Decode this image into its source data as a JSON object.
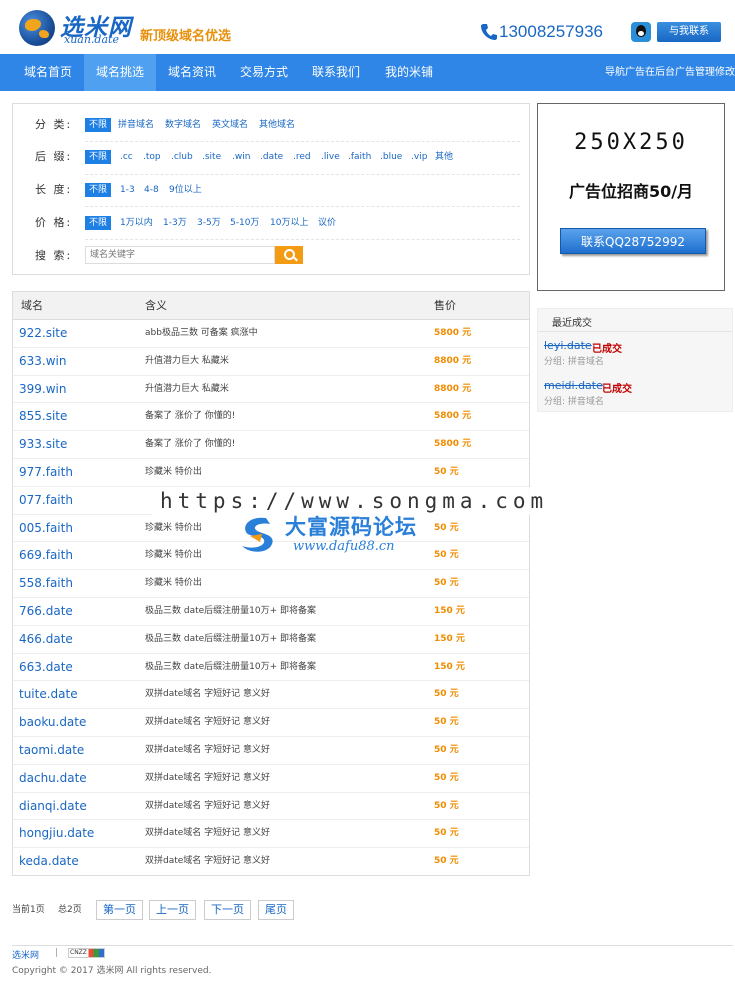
{
  "header": {
    "logo_text": "选米网",
    "logo_sub": "xuan.date",
    "slogan": "新顶级域名优选",
    "phone": "13008257936",
    "contact_button": "与我联系"
  },
  "nav": {
    "items": [
      {
        "label": "域名首页",
        "active": false
      },
      {
        "label": "域名挑选",
        "active": true
      },
      {
        "label": "域名资讯",
        "active": false
      },
      {
        "label": "交易方式",
        "active": false
      },
      {
        "label": "联系我们",
        "active": false
      },
      {
        "label": "我的米铺",
        "active": false
      }
    ],
    "notice": "导航广告在后台广告管理修改"
  },
  "filters": {
    "category": {
      "label": "分 类:",
      "options": [
        "不限",
        "拼音域名",
        "数字域名",
        "英文域名",
        "其他域名"
      ]
    },
    "suffix": {
      "label": "后 缀:",
      "options": [
        "不限",
        ".cc",
        ".top",
        ".club",
        ".site",
        ".win",
        ".date",
        ".red",
        ".live",
        ".faith",
        ".blue",
        ".vip",
        "其他"
      ]
    },
    "length": {
      "label": "长 度:",
      "options": [
        "不限",
        "1-3",
        "4-8",
        "9位以上"
      ]
    },
    "price": {
      "label": "价 格:",
      "options": [
        "不限",
        "1万以内",
        "1-3万",
        "3-5万",
        "5-10万",
        "10万以上",
        "议价"
      ]
    },
    "search": {
      "label": "搜 索:",
      "placeholder": "域名关键字"
    }
  },
  "ad": {
    "size": "250X250",
    "text": "广告位招商50/月",
    "button": "联系QQ28752992"
  },
  "recent": {
    "title": "最近成交",
    "items": [
      {
        "domain": "leyi.date",
        "status": "已成交",
        "category": "分组:  拼音域名"
      },
      {
        "domain": "meidi.date",
        "status": "已成交",
        "category": "分组:  拼音域名"
      }
    ]
  },
  "table": {
    "headers": {
      "domain": "域名",
      "desc": "含义",
      "price": "售价"
    },
    "rows": [
      {
        "domain": "922.site",
        "desc": "abb极品三数 可备案 疯涨中",
        "price": "5800 元"
      },
      {
        "domain": "633.win",
        "desc": "升值潜力巨大 私藏米",
        "price": "8800 元"
      },
      {
        "domain": "399.win",
        "desc": "升值潜力巨大 私藏米",
        "price": "8800 元"
      },
      {
        "domain": "855.site",
        "desc": "备案了 涨价了 你懂的!",
        "price": "5800 元"
      },
      {
        "domain": "933.site",
        "desc": "备案了 涨价了 你懂的!",
        "price": "5800 元"
      },
      {
        "domain": "977.faith",
        "desc": "珍藏米 特价出",
        "price": "50 元"
      },
      {
        "domain": "077.faith",
        "desc": "",
        "price": ""
      },
      {
        "domain": "005.faith",
        "desc": "珍藏米 特价出",
        "price": "50 元"
      },
      {
        "domain": "669.faith",
        "desc": "珍藏米 特价出",
        "price": "50 元"
      },
      {
        "domain": "558.faith",
        "desc": "珍藏米 特价出",
        "price": "50 元"
      },
      {
        "domain": "766.date",
        "desc": "极品三数 date后缀注册量10万+ 即将备案",
        "price": "150 元"
      },
      {
        "domain": "466.date",
        "desc": "极品三数 date后缀注册量10万+ 即将备案",
        "price": "150 元"
      },
      {
        "domain": "663.date",
        "desc": "极品三数 date后缀注册量10万+ 即将备案",
        "price": "150 元"
      },
      {
        "domain": "tuite.date",
        "desc": "双拼date域名 字短好记 意义好",
        "price": "50 元"
      },
      {
        "domain": "baoku.date",
        "desc": "双拼date域名 字短好记 意义好",
        "price": "50 元"
      },
      {
        "domain": "taomi.date",
        "desc": "双拼date域名 字短好记 意义好",
        "price": "50 元"
      },
      {
        "domain": "dachu.date",
        "desc": "双拼date域名 字短好记 意义好",
        "price": "50 元"
      },
      {
        "domain": "dianqi.date",
        "desc": "双拼date域名 字短好记 意义好",
        "price": "50 元"
      },
      {
        "domain": "hongjiu.date",
        "desc": "双拼date域名 字短好记 意义好",
        "price": "50 元"
      },
      {
        "domain": "keda.date",
        "desc": "双拼date域名 字短好记 意义好",
        "price": "50 元"
      }
    ]
  },
  "watermark": {
    "url": "https://www.songma.com",
    "cn_name": "大富源码论坛",
    "site": "www.dafu88.cn"
  },
  "pager": {
    "current": "当前1页",
    "total": "总2页",
    "first": "第一页",
    "prev": "上一页",
    "next": "下一页",
    "last": "尾页"
  },
  "footer": {
    "link": "选米网",
    "sep": "|",
    "badge": "CNZZ",
    "copyright": "Copyright © 2017 选米网 All rights reserved."
  },
  "colors": {
    "brand_blue": "#2f86e6",
    "nav_active": "#4fa0f0",
    "link_blue": "#1967c4",
    "price_orange": "#f08c00",
    "sold_red": "#c00000",
    "search_button": "#f39b13"
  }
}
